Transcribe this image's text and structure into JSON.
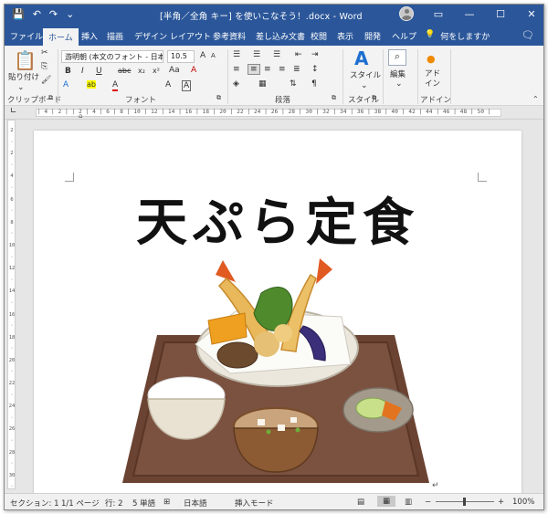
{
  "window": {
    "title": "[半角／全角 キー] を使いこなそう！.docx  -  Word",
    "qat": [
      "💾",
      "↶",
      "↷",
      "⌄"
    ]
  },
  "tabs": [
    "ファイル",
    "ホーム",
    "挿入",
    "描画",
    "デザイン",
    "レイアウト",
    "参考資料",
    "差し込み文書",
    "校閲",
    "表示",
    "開発",
    "ヘルプ"
  ],
  "active_tab": "ホーム",
  "tell_me": "何をしますか",
  "ribbon": {
    "clipboard": {
      "paste_label_1": "貼り付け",
      "paste_label_2": "",
      "group": "クリップボード"
    },
    "font": {
      "font_name": "游明朝 (本文のフォント - 日本語)",
      "font_size": "10.5",
      "group": "フォント",
      "bold": "B",
      "italic": "I",
      "underline": "U",
      "strike": "abc",
      "subscript": "x₂",
      "superscript": "x²",
      "grow": "A",
      "shrink": "A",
      "font_color": "A",
      "highlight": "ab",
      "char_shade": "A",
      "case": "Aa",
      "clear": "A"
    },
    "paragraph": {
      "group": "段落"
    },
    "styles": {
      "label": "スタイル",
      "group": "スタイル"
    },
    "editing": {
      "label": "編集"
    },
    "addins": {
      "label_1": "アド",
      "label_2": "イン",
      "group": "アドイン"
    }
  },
  "ruler": {
    "h": "| 4 | 2 |  | 2 | 4 | 6 | 8 | 10 | 12 | 14 | 16 | 18 | 20 | 22 | 24 | 26 | 28 | 30 | 32 | 34 | 36 | 38 | 40 | 42 | 44 | 46 | 48 | 50 |",
    "v": [
      "2",
      "·",
      "2",
      "·",
      "4",
      "·",
      "6",
      "·",
      "8",
      "·",
      "10",
      "·",
      "12",
      "·",
      "14",
      "·",
      "16",
      "·",
      "18",
      "·",
      "20",
      "·",
      "22",
      "·",
      "24",
      "·",
      "26",
      "·",
      "28",
      "·",
      "30",
      "·"
    ]
  },
  "document": {
    "heading": "天ぷら定食"
  },
  "statusbar": {
    "section": "セクション: 1",
    "page": "1/1 ページ",
    "line": "行: 2",
    "words": "5 単語",
    "language": "日本語",
    "mode": "挿入モード",
    "zoom": "100%",
    "minus": "−",
    "plus": "+"
  },
  "colors": {
    "accent": "#2b579a"
  }
}
